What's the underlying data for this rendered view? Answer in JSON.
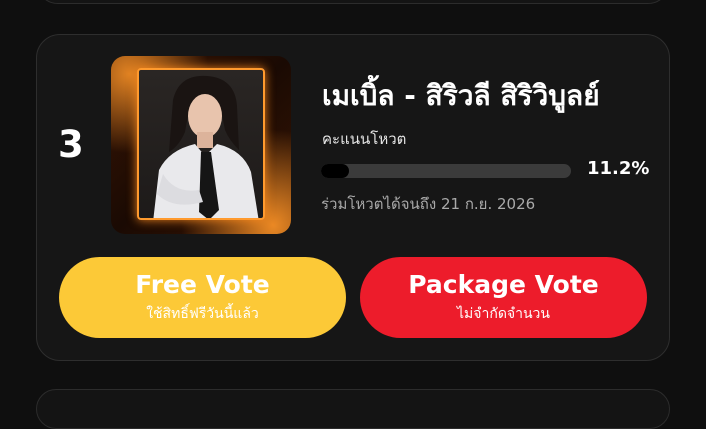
{
  "candidate": {
    "rank": "3",
    "name": "เมเบิ้ล - สิริวลี สิริวิบูลย์",
    "score_label": "คะแนนโหวต",
    "percent_text": "11.2%",
    "percent_value": 11.2,
    "deadline": "ร่วมโหวตได้จนถึง 21 ก.ย. 2026"
  },
  "buttons": {
    "free": {
      "title": "Free Vote",
      "subtitle": "ใช้สิทธิ์ฟรีวันนี้แล้ว"
    },
    "package": {
      "title": "Package Vote",
      "subtitle": "ไม่จำกัดจำนวน"
    }
  },
  "colors": {
    "free_button": "#fcc937",
    "package_button": "#ed1c2b",
    "progress_track": "#3b3b3b",
    "progress_fill": "#000000",
    "frame_glow": "#ff9a2e"
  }
}
